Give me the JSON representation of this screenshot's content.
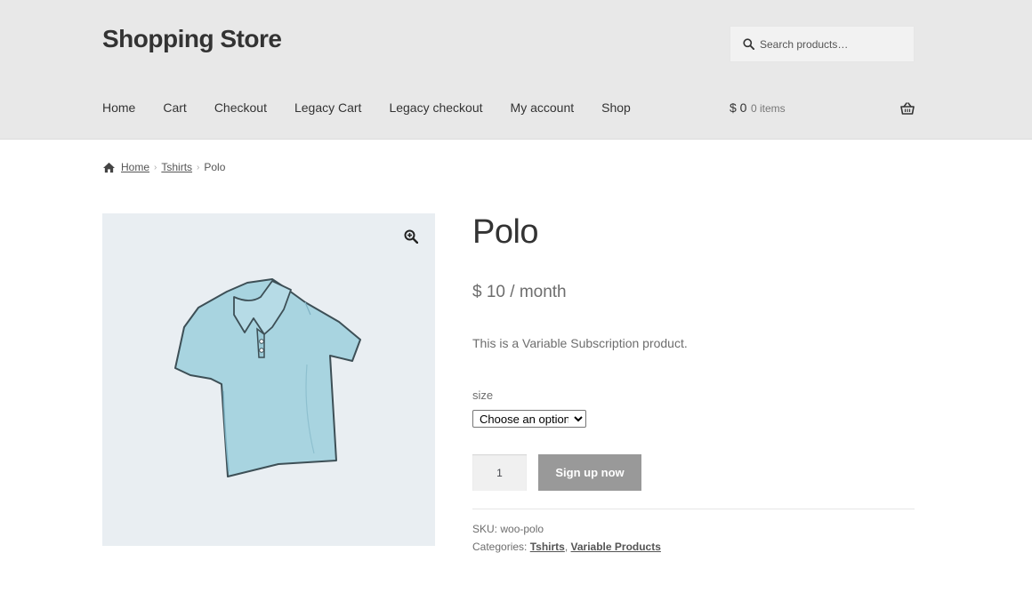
{
  "site": {
    "title": "Shopping Store"
  },
  "search": {
    "placeholder": "Search products…"
  },
  "nav": {
    "items": [
      "Home",
      "Cart",
      "Checkout",
      "Legacy Cart",
      "Legacy checkout",
      "My account",
      "Shop"
    ]
  },
  "cart": {
    "amount": "$ 0",
    "count": "0 items",
    "icon": "basket-icon"
  },
  "breadcrumb": {
    "home": "Home",
    "sep": "›",
    "category": "Tshirts",
    "current": "Polo"
  },
  "product": {
    "title": "Polo",
    "price": "$ 10 / month",
    "description": "This is a Variable Subscription product.",
    "size_label": "size",
    "size_selected": "Choose an option",
    "quantity": "1",
    "button_label": "Sign up now",
    "sku_label": "SKU:",
    "sku_value": "woo-polo",
    "categories_label": "Categories:",
    "categories": [
      "Tshirts",
      "Variable Products"
    ],
    "categories_sep": ","
  },
  "colors": {
    "header_bg": "#e8e8e8",
    "button_bg": "#999999",
    "gallery_bg": "#e9eef2",
    "shirt": "#a8d4e0"
  }
}
